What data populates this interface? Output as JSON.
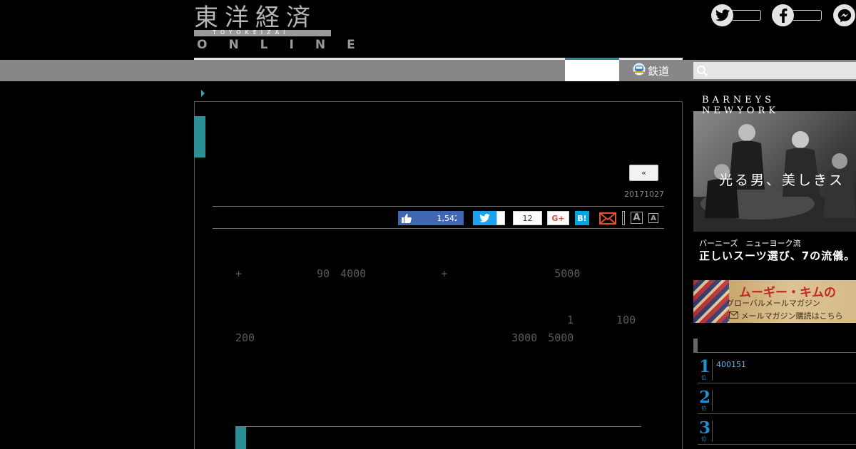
{
  "header": {
    "logo_kanji": "東洋経済",
    "logo_band": "TOYOKEIZAI",
    "logo_online": "ONLINE"
  },
  "nav": {
    "tabs": [
      {
        "label": ""
      },
      {
        "label": "鉄道"
      }
    ],
    "search": {
      "placeholder": "",
      "value": ""
    }
  },
  "article": {
    "back_label": "«",
    "date": "20171027",
    "share": {
      "like_count": "1,542",
      "hatena_count": "12",
      "gplus_label": "G+",
      "hatena_label": "B!",
      "font_large_label": "A",
      "font_small_label": "A"
    },
    "paragraphs": [
      "　　　　　　　　　　　　　　　　　　　　　　　　　　　　　　　　　　　　　　　　+　　　　　　　90　4000　　　　　　　+　　　　　　　　　　5000　　　　　　　　　　　　　　　　　　　　",
      "　　　　　　　　　　　　　　　　　　　　　　　　　　　　　　　1　　　　100　200　　　　　　　　　　　　　　　　　　　　　　　　3000　5000　　　　　　　　　　　　　　　　　　　　　　　　",
      "　　　　　　　　　　　　　　　　　　　　　　　　　　　　　　　　　　　　　　　　　　　　　　　　　　　　　　　　　　　　　　　　　　　　　　　　　　　　　　　　　　　　　　　　　　　　　　　　　　　　"
    ],
    "subhead": "　　　　　　　　　　　　　　　　　　　　"
  },
  "ads": {
    "barneys": {
      "logo_line1": "BARNEYS",
      "logo_line2": "NEWYORK",
      "tagline": "光る男、美しきス",
      "sub1": "バーニーズ　ニューヨーク流",
      "sub2": "正しいスーツ選び、7の流儀。"
    },
    "kim": {
      "title": "ムーギー・キムの",
      "sub": "グローバルメールマガジン",
      "cta": "メールマガジン購読はこちら"
    }
  },
  "ranking": {
    "unit": "位",
    "items": [
      {
        "rank": "1",
        "text": "400151"
      },
      {
        "rank": "2",
        "text": ""
      },
      {
        "rank": "3",
        "text": ""
      }
    ]
  },
  "colors": {
    "accent_teal": "#2b8f95",
    "facebook_blue": "#4267b2",
    "twitter_blue": "#1da1f2",
    "rank_blue": "#1f8fd0"
  },
  "icons": [
    "twitter-icon",
    "facebook-icon",
    "messenger-icon",
    "train-icon",
    "search-icon",
    "thumbs-up-icon",
    "mail-icon"
  ]
}
